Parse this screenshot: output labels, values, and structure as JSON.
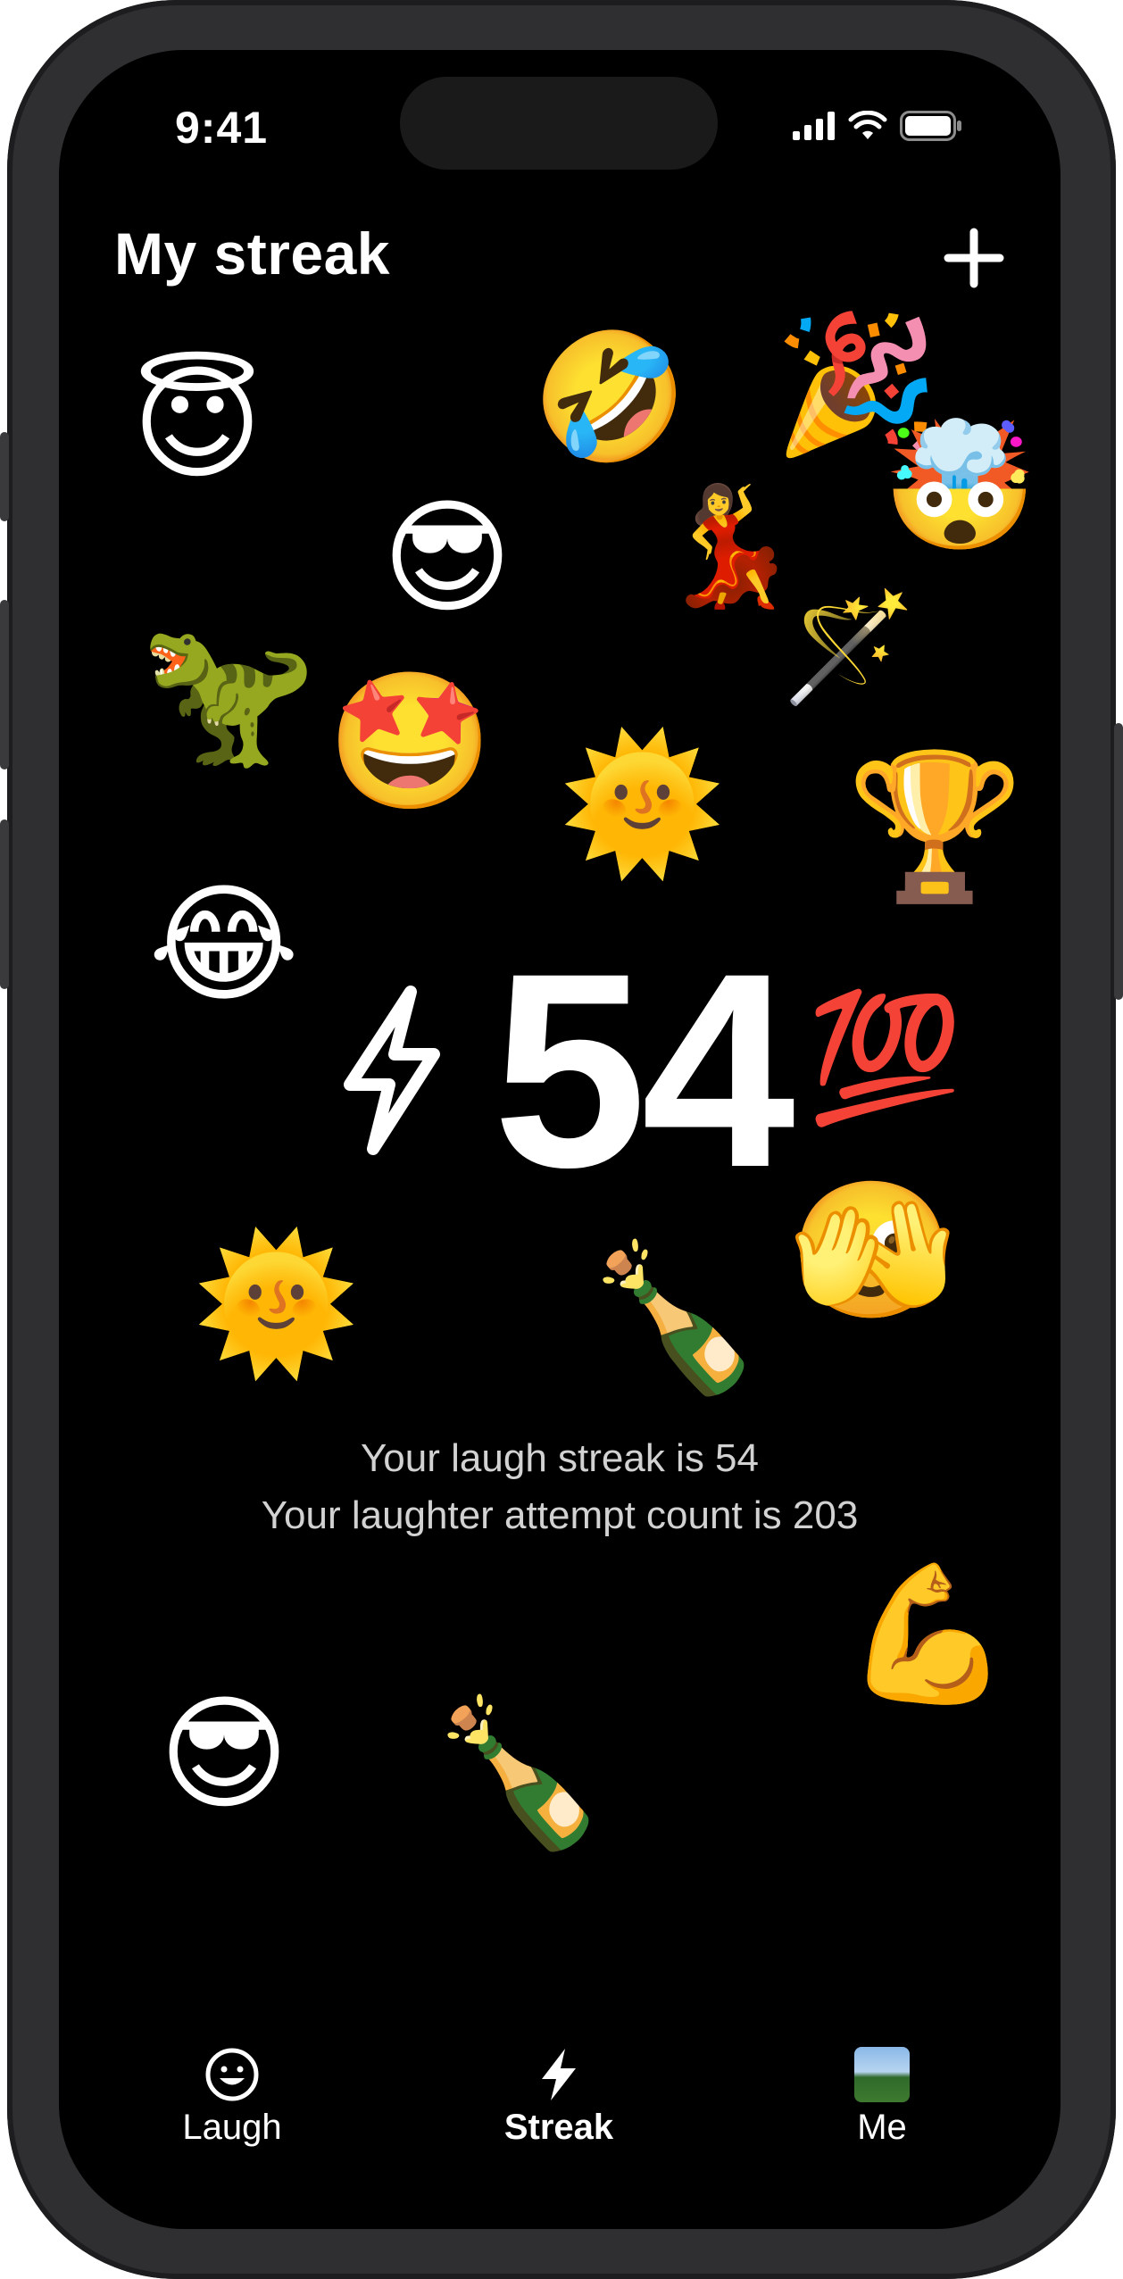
{
  "status_bar": {
    "time": "9:41"
  },
  "header": {
    "title": "My streak",
    "add_icon": "plus-icon"
  },
  "streak": {
    "icon": "lightning-bolt-icon",
    "count": "54"
  },
  "summary": {
    "line1": "Your laugh streak is 54",
    "line2": "Your laughter attempt count is 203"
  },
  "decorations": {
    "halo": "😇",
    "rolling": "🤣",
    "party": "🎉",
    "exploding": "🤯",
    "cool": "😎",
    "dancer": "💃",
    "wand": "🪄",
    "dino": "🦖",
    "starstruck": "🤩",
    "sun1": "🌞",
    "trophy": "🏆",
    "joy": "😂",
    "hundred": "💯",
    "peek": "🫣",
    "sun2": "🌞",
    "champagne1": "🍾",
    "muscle": "💪",
    "cool2": "😎",
    "champagne2": "🍾"
  },
  "tabs": [
    {
      "label": "Laugh",
      "icon": "smiley-face-icon",
      "active": false
    },
    {
      "label": "Streak",
      "icon": "lightning-bolt-icon",
      "active": true
    },
    {
      "label": "Me",
      "icon": "avatar-photo",
      "active": false
    }
  ],
  "colors": {
    "background": "#000000",
    "text": "#ffffff",
    "secondary_text": "#d2d2d2",
    "frame": "#2f2f31"
  }
}
